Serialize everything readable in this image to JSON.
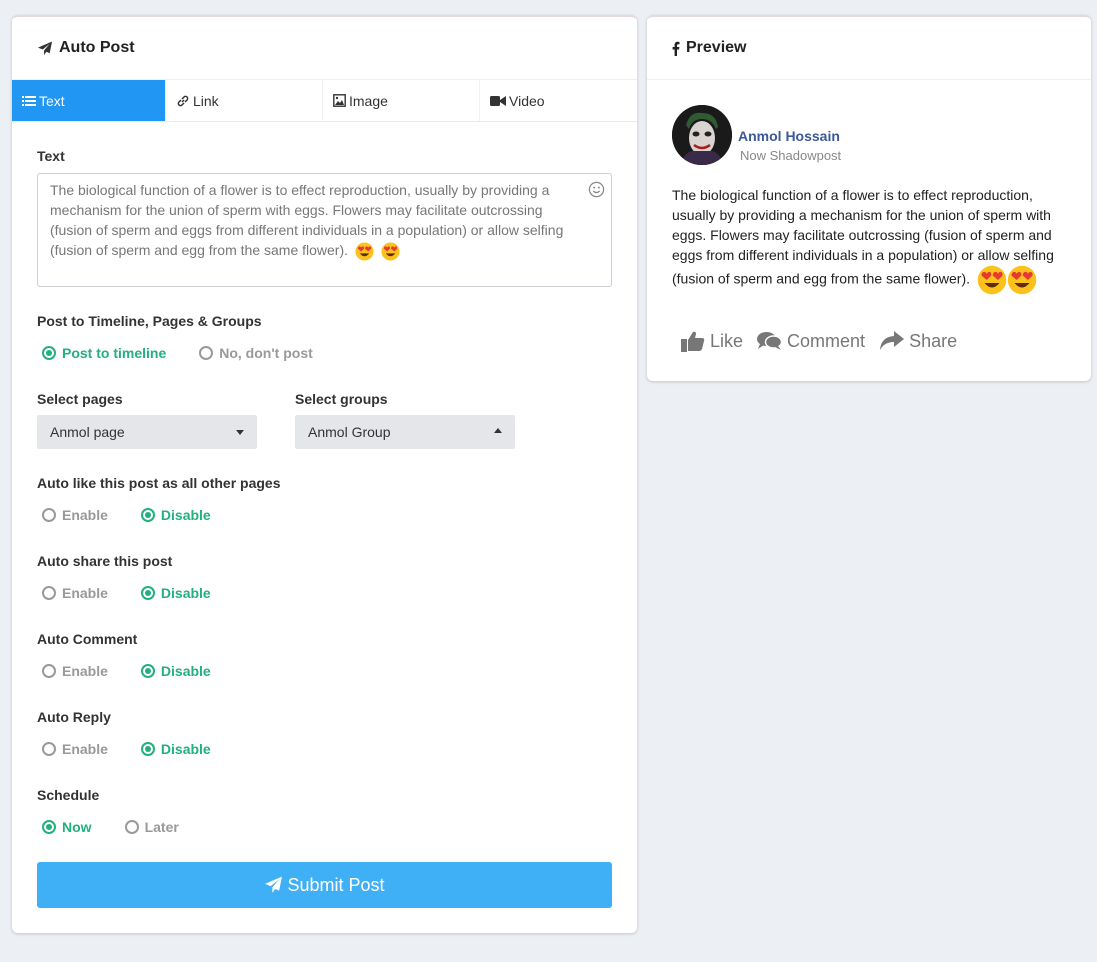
{
  "left": {
    "title": "Auto Post",
    "tabs": [
      {
        "label": "Text",
        "icon": "list-icon"
      },
      {
        "label": "Link",
        "icon": "link-icon"
      },
      {
        "label": "Image",
        "icon": "image-icon"
      },
      {
        "label": "Video",
        "icon": "video-icon"
      }
    ],
    "text_label": "Text",
    "text_value": "The biological function of a flower is to effect reproduction, usually by providing a mechanism for the union of sperm with eggs. Flowers may facilitate outcrossing (fusion of sperm and eggs from different individuals in a population) or allow selfing (fusion of sperm and egg from the same flower).",
    "post_to_label": "Post to Timeline, Pages & Groups",
    "post_to_options": [
      "Post to timeline",
      "No, don't post"
    ],
    "select_pages_label": "Select pages",
    "select_pages_value": "Anmol page",
    "select_groups_label": "Select groups",
    "select_groups_value": "Anmol Group",
    "auto_like_label": "Auto like this post as all other pages",
    "auto_share_label": "Auto share this post",
    "auto_comment_label": "Auto Comment",
    "auto_reply_label": "Auto Reply",
    "enable_label": "Enable",
    "disable_label": "Disable",
    "schedule_label": "Schedule",
    "schedule_options": [
      "Now",
      "Later"
    ],
    "submit_label": "Submit Post"
  },
  "right": {
    "title": "Preview",
    "user_name": "Anmol Hossain",
    "user_sub": "Now Shadowpost",
    "post_text": "The biological function of a flower is to effect reproduction, usually by providing a mechanism for the union of sperm with eggs. Flowers may facilitate outcrossing (fusion of sperm and eggs from different individuals in a population) or allow selfing (fusion of sperm and egg from the same flower).",
    "like_label": "Like",
    "comment_label": "Comment",
    "share_label": "Share"
  },
  "colors": {
    "accent": "#2196f3",
    "green": "#22b07d",
    "submit": "#40b0f6",
    "fb_name": "#3b5998"
  }
}
